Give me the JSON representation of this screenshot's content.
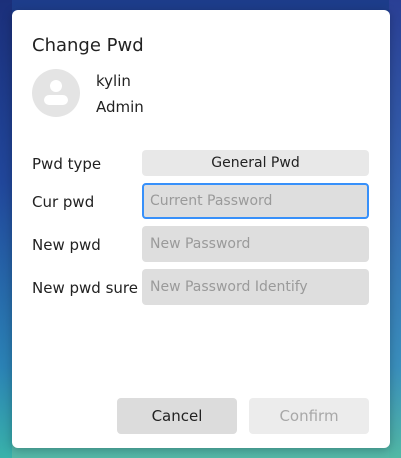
{
  "dialog": {
    "title": "Change Pwd",
    "user": {
      "name": "kylin",
      "type": "Admin"
    },
    "form": {
      "pwd_type_label": "Pwd type",
      "pwd_type_value": "General Pwd",
      "cur_pwd_label": "Cur pwd",
      "cur_pwd_placeholder": "Current Password",
      "new_pwd_label": "New pwd",
      "new_pwd_placeholder": "New Password",
      "new_pwd_sure_label": "New pwd sure",
      "new_pwd_sure_placeholder": "New Password Identify"
    },
    "buttons": {
      "cancel": "Cancel",
      "confirm": "Confirm"
    }
  },
  "colors": {
    "focus_border": "#3790fa",
    "field_bg": "#dedede",
    "disabled_text": "#a8a8a8"
  }
}
